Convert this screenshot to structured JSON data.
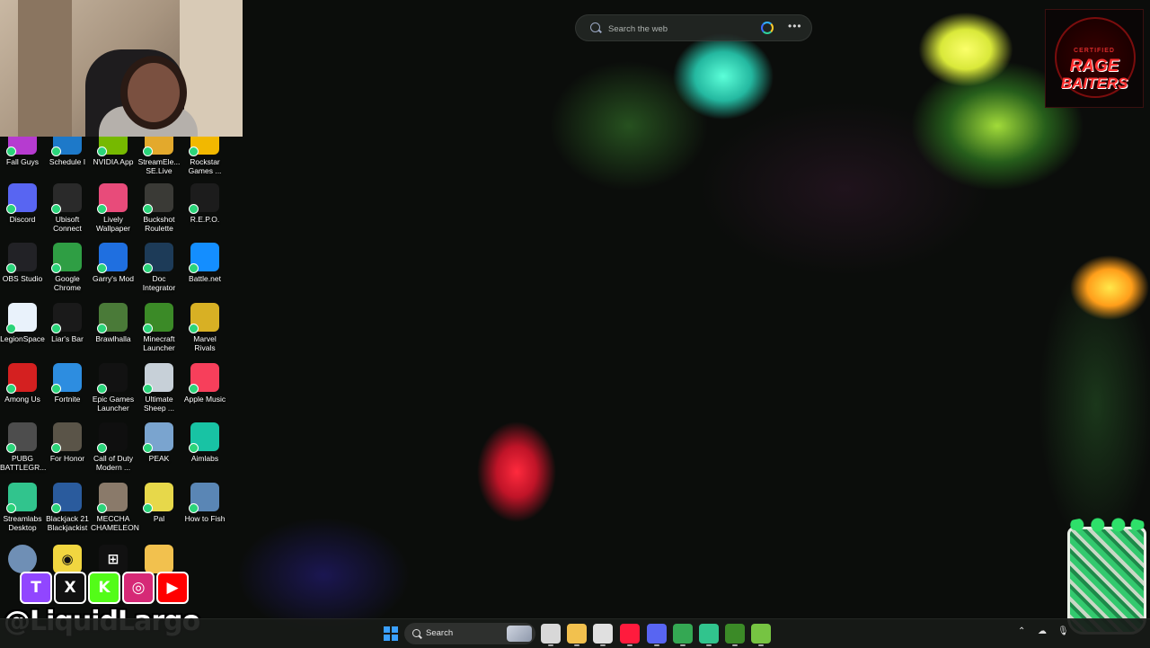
{
  "search": {
    "placeholder": "Search the web"
  },
  "badge": {
    "line1": "CERTIFIED",
    "line2": "RAGE",
    "line3": "BAITERS"
  },
  "desktop_icons": [
    {
      "label": "Fall Guys",
      "color": "#b63bd0"
    },
    {
      "label": "Schedule I",
      "color": "#1d79c9"
    },
    {
      "label": "NVIDIA App",
      "color": "#76b900"
    },
    {
      "label": "StreamEle... SE.Live",
      "color": "#e3a92c"
    },
    {
      "label": "Rockstar Games ...",
      "color": "#f2b800"
    },
    {
      "label": "Discord",
      "color": "#5865f2"
    },
    {
      "label": "Ubisoft Connect",
      "color": "#2a2a2a"
    },
    {
      "label": "Lively Wallpaper",
      "color": "#e84b7a"
    },
    {
      "label": "Buckshot Roulette",
      "color": "#3a3a36"
    },
    {
      "label": "R.E.P.O.",
      "color": "#1c1c1c"
    },
    {
      "label": "OBS Studio",
      "color": "#222226"
    },
    {
      "label": "Google Chrome",
      "color": "#2f9e44"
    },
    {
      "label": "Garry's Mod",
      "color": "#1f6fe0"
    },
    {
      "label": "Doc Integrator",
      "color": "#1d3b58"
    },
    {
      "label": "Battle.net",
      "color": "#148eff"
    },
    {
      "label": "LegionSpace",
      "color": "#e9f2fb"
    },
    {
      "label": "Liar's Bar",
      "color": "#1a1a1a"
    },
    {
      "label": "Brawlhalla",
      "color": "#4a7a38"
    },
    {
      "label": "Minecraft Launcher",
      "color": "#3b8a27"
    },
    {
      "label": "Marvel Rivals",
      "color": "#d8b024"
    },
    {
      "label": "Among Us",
      "color": "#d42020"
    },
    {
      "label": "Fortnite",
      "color": "#2d8de0"
    },
    {
      "label": "Epic Games Launcher",
      "color": "#121212"
    },
    {
      "label": "Ultimate Sheep ...",
      "color": "#c7d0d8"
    },
    {
      "label": "Apple Music",
      "color": "#f73f5b"
    },
    {
      "label": "PUBG BATTLEGR...",
      "color": "#4d4d4d"
    },
    {
      "label": "For Honor",
      "color": "#5a5448"
    },
    {
      "label": "Call of Duty Modern ...",
      "color": "#0f0f0f"
    },
    {
      "label": "PEAK",
      "color": "#7aa4cf"
    },
    {
      "label": "Aimlabs",
      "color": "#18c3a4"
    },
    {
      "label": "Streamlabs Desktop",
      "color": "#31c48d"
    },
    {
      "label": "Blackjack 21 Blackjackist",
      "color": "#2a5b9d"
    },
    {
      "label": "MECCHA CHAMELEON",
      "color": "#8a7a6a"
    },
    {
      "label": "Pal",
      "color": "#e7d84a"
    },
    {
      "label": "How to Fish",
      "color": "#5a86b5"
    }
  ],
  "overlay": {
    "handle": "@LiquidLargo",
    "socials": [
      {
        "icon": "twitch-icon",
        "glyph": "T",
        "color": "#9146ff"
      },
      {
        "icon": "x-icon",
        "glyph": "X",
        "color": "#111111"
      },
      {
        "icon": "kick-icon",
        "glyph": "K",
        "color": "#53fc18"
      },
      {
        "icon": "instagram-icon",
        "glyph": "◎",
        "color": "#d62976"
      },
      {
        "icon": "youtube-icon",
        "glyph": "▶",
        "color": "#ff0000"
      }
    ]
  },
  "taskbar": {
    "search_label": "Search",
    "apps": [
      {
        "icon": "task-view-icon",
        "color": "#d8d8d8"
      },
      {
        "icon": "file-explorer-icon",
        "color": "#f2c14e"
      },
      {
        "icon": "steam-icon",
        "color": "#e0e0e0"
      },
      {
        "icon": "opera-gx-icon",
        "color": "#ff1b3d"
      },
      {
        "icon": "discord-icon",
        "color": "#5865f2"
      },
      {
        "icon": "chrome-icon",
        "color": "#34a853"
      },
      {
        "icon": "streamlabs-icon",
        "color": "#31c48d"
      },
      {
        "icon": "minecraft-icon",
        "color": "#3b8a27"
      },
      {
        "icon": "minecraft-launcher-icon",
        "color": "#76c442"
      }
    ]
  },
  "colors": {
    "taskbar_bg": "#181a18",
    "accent": "#3aa0ff"
  }
}
